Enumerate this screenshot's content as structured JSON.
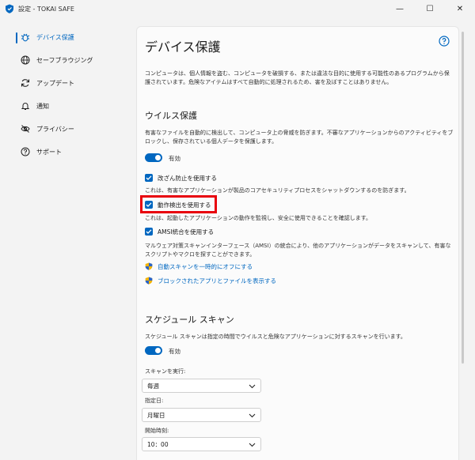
{
  "window": {
    "title": "設定 - TOKAI SAFE",
    "minimize": "—",
    "maximize": "☐",
    "close": "✕"
  },
  "sidebar": {
    "items": [
      {
        "label": "デバイス保護",
        "icon": "bug-icon",
        "active": true
      },
      {
        "label": "セーフブラウジング",
        "icon": "globe-icon"
      },
      {
        "label": "アップデート",
        "icon": "refresh-icon"
      },
      {
        "label": "通知",
        "icon": "bell-icon"
      },
      {
        "label": "プライバシー",
        "icon": "eye-off-icon"
      },
      {
        "label": "サポート",
        "icon": "help-icon"
      }
    ]
  },
  "main": {
    "title": "デバイス保護",
    "intro": "コンピュータは、個人情報を盗む、コンピュータを破損する、または違法な目的に使用する可能性のあるプログラムから保護されています。危険なアイテムはすべて自動的に処理されるため、害を及ぼすことはありません。",
    "virus": {
      "title": "ウイルス保護",
      "desc": "有害なファイルを自動的に検出して、コンピュータ上の脅威を防ぎます。不審なアプリケーションからのアクティビティをブロックし、保存されている個人データを保護します。",
      "toggle_label": "有効",
      "tamper_label": "改ざん防止を使用する",
      "tamper_desc": "これは、有害なアプリケーションが製品のコアセキュリティプロセスをシャットダウンするのを防ぎます。",
      "behavior_label": "動作検出を使用する",
      "behavior_desc": "これは、起動したアプリケーションの動作を監視し、安全に使用できることを確認します。",
      "amsi_label": "AMSI統合を使用する",
      "amsi_desc": "マルウェア対策スキャンインターフェース（AMSI）の統合により、他のアプリケーションがデータをスキャンして、有害なスクリプトやマクロを探すことができます。",
      "link1": "自動スキャンを一時的にオフにする",
      "link2": "ブロックされたアプリとファイルを表示する"
    },
    "schedule": {
      "title": "スケジュール スキャン",
      "desc": "スケジュール スキャンは指定の時間でウイルスと危険なアプリケーションに対するスキャンを行います。",
      "toggle_label": "有効",
      "run_label": "スキャンを実行:",
      "run_value": "毎週",
      "day_label": "指定日:",
      "day_value": "月曜日",
      "time_label": "開始時刻:",
      "time_value": "10：00"
    }
  },
  "colors": {
    "accent": "#0067c0",
    "highlight": "#e8000b"
  }
}
